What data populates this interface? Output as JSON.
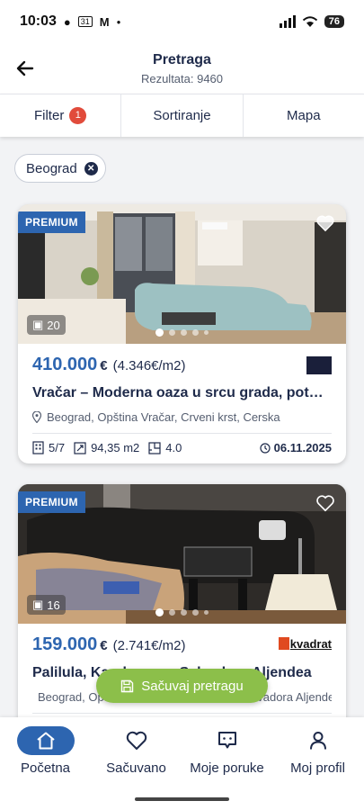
{
  "status_bar": {
    "time": "10:03",
    "calendar_day": "31",
    "battery": "76"
  },
  "header": {
    "title": "Pretraga",
    "subtitle": "Rezultata: 9460"
  },
  "toolbar": {
    "filter_label": "Filter",
    "filter_count": "1",
    "sort_label": "Sortiranje",
    "map_label": "Mapa"
  },
  "chips": [
    {
      "label": "Beograd"
    }
  ],
  "listings": [
    {
      "badge": "PREMIUM",
      "photo_count": "20",
      "price": "410.000",
      "currency": "€",
      "price_per_m2": "(4.346€/m2)",
      "title": "Vračar – Moderna oaza u srcu grada, potpuno opremljen stan",
      "location": "Beograd, Opština Vračar, Crveni krst, Cerska",
      "floor": "5/7",
      "area": "94,35 m2",
      "rooms": "4.0",
      "date": "06.11.2025",
      "agency_logo_text": ""
    },
    {
      "badge": "PREMIUM",
      "photo_count": "16",
      "price": "159.000",
      "currency": "€",
      "price_per_m2": "(2.741€/m2)",
      "title": "Palilula, Karaburma - Salvadora Aljendea",
      "location": "Beograd, Opština Palilula, Karaburma, Salvadora Aljendea",
      "agency_logo_text": "kvadrat"
    }
  ],
  "save_search_label": "Sačuvaj pretragu",
  "bottom_nav": [
    {
      "label": "Početna",
      "icon": "home-icon",
      "active": true
    },
    {
      "label": "Sačuvano",
      "icon": "heart-icon",
      "active": false
    },
    {
      "label": "Moje poruke",
      "icon": "chat-icon",
      "active": false
    },
    {
      "label": "Moj profil",
      "icon": "user-icon",
      "active": false
    }
  ],
  "colors": {
    "accent_blue": "#2d65b0",
    "save_green": "#8cbf4a",
    "badge_red": "#e14b3b",
    "text_dark": "#1e2a4a"
  }
}
